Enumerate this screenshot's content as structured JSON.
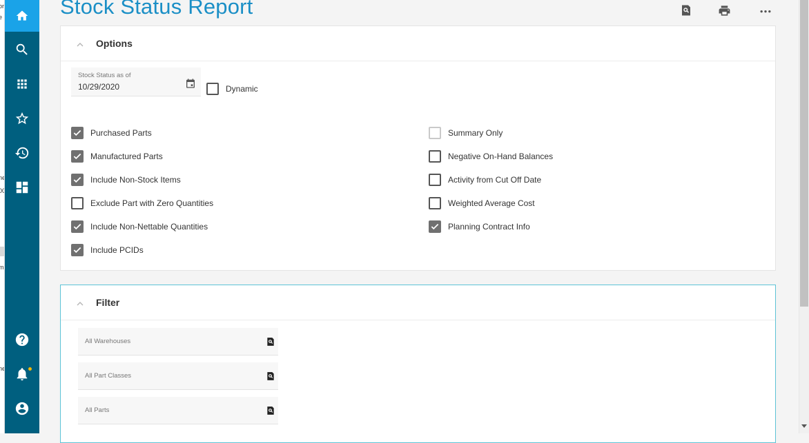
{
  "page": {
    "title": "Stock Status Report"
  },
  "left_strip_fragments": [
    "or",
    "e",
    "ne",
    "00",
    "m",
    "ne"
  ],
  "sidebar": {
    "items": [
      {
        "icon": "home-icon",
        "active": true
      },
      {
        "icon": "search-icon"
      },
      {
        "icon": "apps-grid-icon"
      },
      {
        "icon": "star-icon"
      },
      {
        "icon": "history-icon"
      },
      {
        "icon": "dashboard-icon"
      },
      {
        "icon": "help-icon"
      },
      {
        "icon": "notifications-icon",
        "badge_color": "#f2b705"
      },
      {
        "icon": "account-icon"
      }
    ],
    "bg_color": "#005f7f",
    "active_color": "#1aa3e8"
  },
  "toolbar": {
    "preview_icon": "preview-search-icon",
    "print_icon": "print-icon",
    "more_icon": "more-horizontal-icon"
  },
  "options": {
    "header": "Options",
    "date_field": {
      "label": "Stock Status as of",
      "value": "10/29/2020",
      "icon": "calendar-icon"
    },
    "dynamic": {
      "label": "Dynamic",
      "checked": false
    },
    "left_column": [
      {
        "label": "Purchased Parts",
        "checked": true
      },
      {
        "label": "Manufactured Parts",
        "checked": true
      },
      {
        "label": "Include Non-Stock Items",
        "checked": true
      },
      {
        "label": "Exclude Part with Zero Quantities",
        "checked": false
      },
      {
        "label": "Include Non-Nettable Quantities",
        "checked": true
      },
      {
        "label": "Include PCIDs",
        "checked": true
      }
    ],
    "right_column": [
      {
        "label": "Summary Only",
        "checked": false,
        "disabled": true
      },
      {
        "label": "Negative On-Hand Balances",
        "checked": false
      },
      {
        "label": "Activity from Cut Off Date",
        "checked": false
      },
      {
        "label": "Weighted Average Cost",
        "checked": false
      },
      {
        "label": "Planning Contract Info",
        "checked": true
      }
    ]
  },
  "filter": {
    "header": "Filter",
    "fields": [
      {
        "placeholder": "All Warehouses"
      },
      {
        "placeholder": "All Part Classes"
      },
      {
        "placeholder": "All Parts"
      }
    ]
  },
  "colors": {
    "title": "#1b8fc6",
    "checked_box": "#707070",
    "filter_border": "#5cc3d6"
  }
}
